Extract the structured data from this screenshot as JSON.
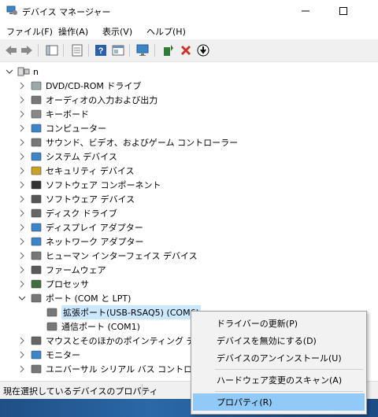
{
  "window": {
    "title": "デバイス マネージャー",
    "app_icon": "device-manager-icon"
  },
  "menubar": {
    "items": [
      "ファイル(F)",
      "操作(A)",
      "表示(V)",
      "ヘルプ(H)"
    ]
  },
  "tree": {
    "root": "n",
    "categories": [
      "DVD/CD-ROM ドライブ",
      "オーディオの入力および出力",
      "キーボード",
      "コンピューター",
      "サウンド、ビデオ、およびゲーム コントローラー",
      "システム デバイス",
      "セキュリティ デバイス",
      "ソフトウェア コンポーネント",
      "ソフトウェア デバイス",
      "ディスク ドライブ",
      "ディスプレイ アダプター",
      "ネットワーク アダプター",
      "ヒューマン インターフェイス デバイス",
      "ファームウェア",
      "プロセッサ",
      "ポート (COM と LPT)"
    ],
    "ports_children": [
      "拡張ポート(USB-RSAQ5) (COM6)",
      "通信ポート (COM1)"
    ],
    "after": [
      "マウスとそのほかのポインティング デバイス",
      "モニター",
      "ユニバーサル シリアル バス コントローラー"
    ]
  },
  "context_menu": {
    "items": [
      "ドライバーの更新(P)",
      "デバイスを無効にする(D)",
      "デバイスのアンインストール(U)",
      "ハードウェア変更のスキャン(A)",
      "プロパティ(R)"
    ],
    "highlighted": "プロパティ(R)"
  },
  "statusbar": {
    "text": "現在選択しているデバイスのプロパティ"
  },
  "colors": {
    "selection": "#cce8ff",
    "menu_hover": "#91c9f7",
    "delete": "#d32f2f",
    "help": "#2a5fb0"
  }
}
